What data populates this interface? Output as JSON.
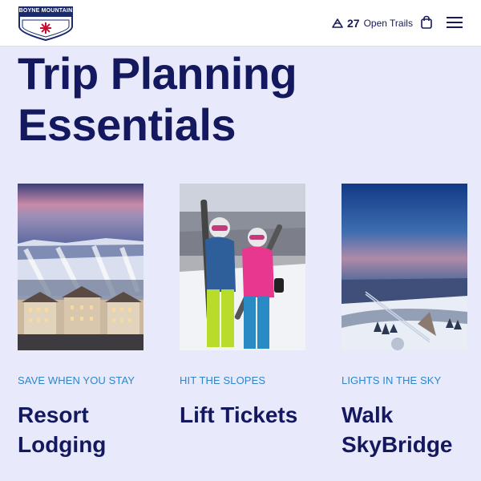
{
  "header": {
    "logo_text": "BOYNE MOUNTAIN",
    "trails_count": "27",
    "trails_label": "Open Trails",
    "trails_icon": "mountain-icon",
    "cart_icon": "shopping-bag-icon",
    "menu_icon": "hamburger-menu-icon"
  },
  "main": {
    "title": "Trip Planning Essentials"
  },
  "cards": [
    {
      "eyebrow": "SAVE WHEN YOU STAY",
      "title": "Resort Lodging"
    },
    {
      "eyebrow": "HIT THE SLOPES",
      "title": "Lift Tickets"
    },
    {
      "eyebrow": "LIGHTS IN THE SKY",
      "title": "Walk SkyBridge"
    }
  ],
  "colors": {
    "navy": "#14185e",
    "accent_blue": "#2e86c9",
    "page_bg": "#e8e9fb",
    "logo_red": "#c8102e"
  }
}
